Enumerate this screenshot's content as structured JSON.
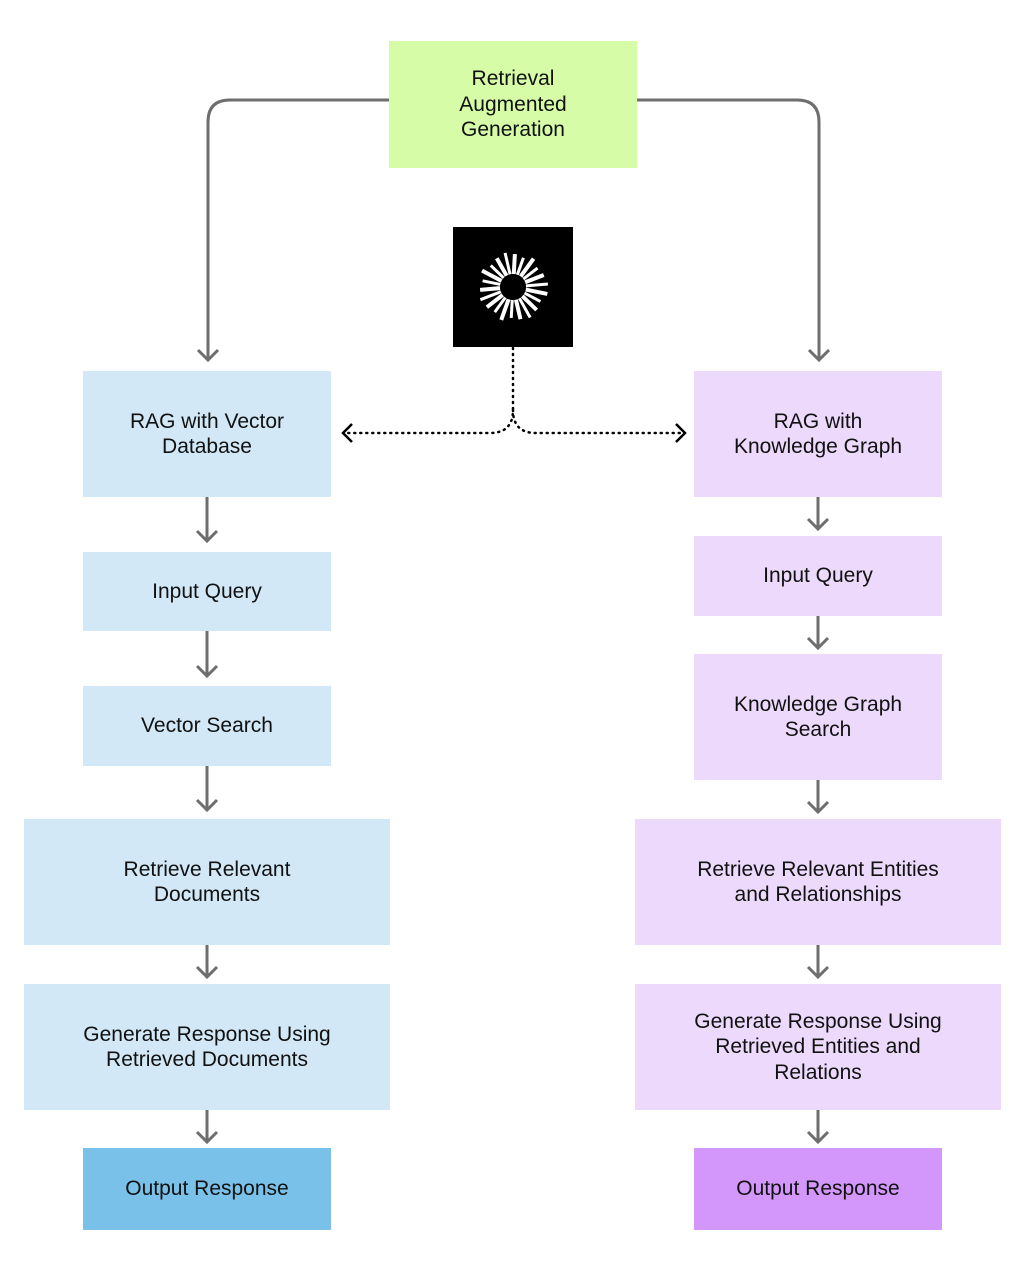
{
  "diagram": {
    "root": {
      "label": "Retrieval\nAugmented\nGeneration",
      "color": "#d7fca8"
    },
    "logo": {
      "icon": "radial-burst-icon",
      "background": "#000000",
      "foreground": "#ffffff"
    },
    "branches": [
      {
        "name": "vector",
        "color": "#d2e8f6",
        "output_color": "#79c1e9",
        "steps": [
          "RAG with Vector\nDatabase",
          "Input Query",
          "Vector Search",
          "Retrieve Relevant\nDocuments",
          "Generate Response Using\nRetrieved Documents",
          "Output Response"
        ]
      },
      {
        "name": "knowledge-graph",
        "color": "#ecd9fb",
        "output_color": "#d397fb",
        "steps": [
          "RAG with\nKnowledge Graph",
          "Input Query",
          "Knowledge Graph\nSearch",
          "Retrieve Relevant Entities\nand Relationships",
          "Generate Response Using\nRetrieved Entities and\nRelations",
          "Output Response"
        ]
      }
    ],
    "connector_color": "#6e6e6e",
    "dotted_connector_color": "#000000"
  }
}
